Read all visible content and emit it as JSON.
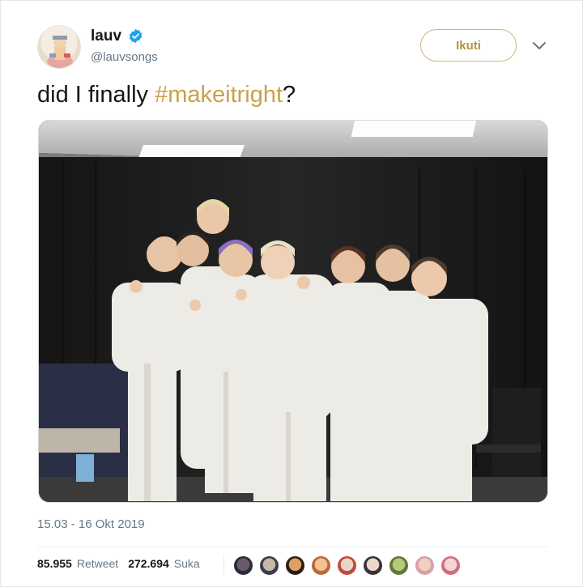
{
  "user": {
    "name": "lauv",
    "handle": "@lauvsongs",
    "verified": true,
    "follow_label": "Ikuti"
  },
  "tweet": {
    "text_prefix": "did I finally ",
    "hashtag": "#makeitright",
    "text_suffix": "?",
    "timestamp": "15.03 - 16 Okt 2019"
  },
  "stats": {
    "retweets": "85.955",
    "retweet_label": "Retweet",
    "likes": "272.694",
    "like_label": "Suka"
  },
  "colors": {
    "accent_gold": "#c9a14a",
    "verified_blue": "#1da1f2",
    "secondary_text": "#657786"
  },
  "icons": [
    "verified-badge-icon",
    "chevron-down-icon"
  ],
  "likers": [
    "liker-avatar",
    "liker-avatar",
    "liker-avatar",
    "liker-avatar",
    "liker-avatar",
    "liker-avatar",
    "liker-avatar",
    "liker-avatar",
    "liker-avatar"
  ]
}
